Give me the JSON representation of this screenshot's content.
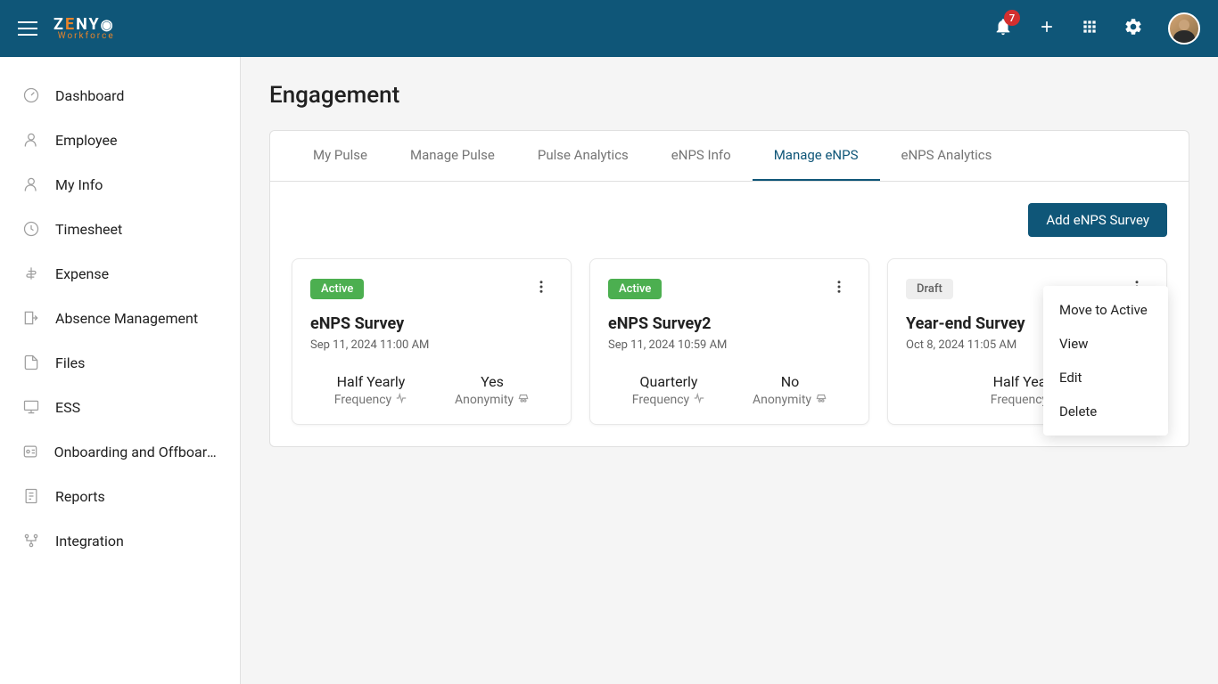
{
  "header": {
    "logo_line1": "ZENYO",
    "logo_line2": "Workforce",
    "notification_count": "7"
  },
  "sidebar": {
    "items": [
      {
        "label": "Dashboard",
        "icon": "gauge"
      },
      {
        "label": "Employee",
        "icon": "person"
      },
      {
        "label": "My Info",
        "icon": "person"
      },
      {
        "label": "Timesheet",
        "icon": "clock"
      },
      {
        "label": "Expense",
        "icon": "money"
      },
      {
        "label": "Absence Management",
        "icon": "exit"
      },
      {
        "label": "Files",
        "icon": "file"
      },
      {
        "label": "ESS",
        "icon": "screen"
      },
      {
        "label": "Onboarding and Offboardi...",
        "icon": "badge"
      },
      {
        "label": "Reports",
        "icon": "report"
      },
      {
        "label": "Integration",
        "icon": "nodes"
      }
    ]
  },
  "page": {
    "title": "Engagement"
  },
  "tabs": [
    {
      "label": "My Pulse",
      "active": false
    },
    {
      "label": "Manage Pulse",
      "active": false
    },
    {
      "label": "Pulse Analytics",
      "active": false
    },
    {
      "label": "eNPS Info",
      "active": false
    },
    {
      "label": "Manage eNPS",
      "active": true
    },
    {
      "label": "eNPS Analytics",
      "active": false
    }
  ],
  "actions": {
    "add_button": "Add eNPS Survey"
  },
  "labels": {
    "frequency": "Frequency",
    "anonymity": "Anonymity"
  },
  "cards": [
    {
      "status": "Active",
      "status_type": "active",
      "title": "eNPS Survey",
      "date": "Sep 11, 2024  11:00 AM",
      "frequency": "Half Yearly",
      "anonymity": "Yes"
    },
    {
      "status": "Active",
      "status_type": "active",
      "title": "eNPS Survey2",
      "date": "Sep 11, 2024  10:59 AM",
      "frequency": "Quarterly",
      "anonymity": "No"
    },
    {
      "status": "Draft",
      "status_type": "draft",
      "title": "Year-end Survey",
      "date": "Oct 8, 2024  11:05 AM",
      "frequency": "Half Yearly",
      "anonymity": ""
    }
  ],
  "dropdown": {
    "items": [
      "Move to Active",
      "View",
      "Edit",
      "Delete"
    ]
  }
}
